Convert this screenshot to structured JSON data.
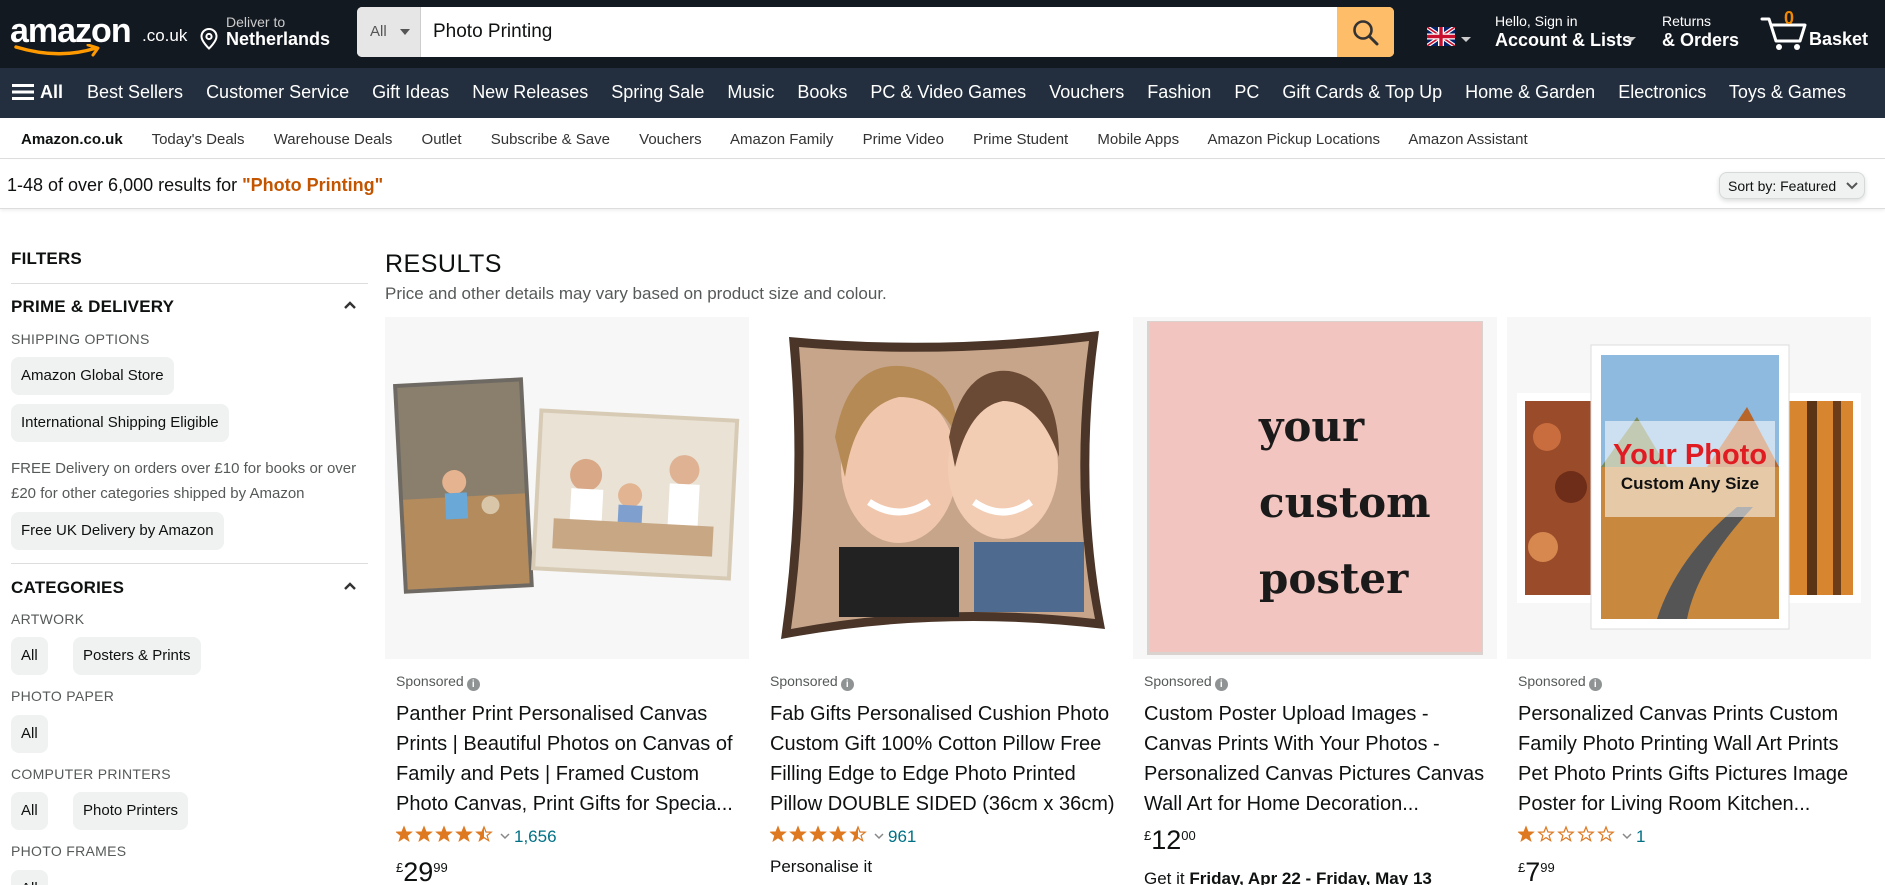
{
  "header": {
    "logo_text": "amazon",
    "logo_tld": ".co.uk",
    "deliver_line1": "Deliver to",
    "deliver_line2": "Netherlands",
    "search_category": "All",
    "search_query": "Photo Printing",
    "account_line1": "Hello, Sign in",
    "account_line2": "Account & Lists",
    "orders_line1": "Returns",
    "orders_line2": "& Orders",
    "basket_count": "0",
    "basket_label": "Basket",
    "accent_color": "#febd69"
  },
  "main_nav": {
    "all_label": "All",
    "items": [
      "Best Sellers",
      "Customer Service",
      "Gift Ideas",
      "New Releases",
      "Spring Sale",
      "Music",
      "Books",
      "PC & Video Games",
      "Vouchers",
      "Fashion",
      "PC",
      "Gift Cards & Top Up",
      "Home & Garden",
      "Electronics",
      "Toys & Games"
    ]
  },
  "sub_nav": {
    "items": [
      "Amazon.co.uk",
      "Today's Deals",
      "Warehouse Deals",
      "Outlet",
      "Subscribe & Save",
      "Vouchers",
      "Amazon Family",
      "Prime Video",
      "Prime Student",
      "Mobile Apps",
      "Amazon Pickup Locations",
      "Amazon Assistant"
    ]
  },
  "results_bar": {
    "count_text": "1-48 of over 6,000 results for ",
    "query_text": "\"Photo Printing\"",
    "sort_label": "Sort by:  Featured"
  },
  "filters": {
    "title": "FILTERS",
    "prime_section": "PRIME & DELIVERY",
    "shipping_options": "SHIPPING OPTIONS",
    "chip_global_store": "Amazon Global Store",
    "chip_international": "International Shipping Eligible",
    "free_delivery_note": "FREE Delivery on orders over £10 for books or over £20 for other categories shipped by Amazon",
    "chip_free_uk": "Free UK Delivery by Amazon",
    "categories_section": "CATEGORIES",
    "artwork": "ARTWORK",
    "chip_all": "All",
    "chip_posters": "Posters & Prints",
    "photo_paper": "PHOTO PAPER",
    "computer_printers": "COMPUTER PRINTERS",
    "chip_photo_printers": "Photo Printers",
    "photo_frames": "PHOTO FRAMES"
  },
  "results": {
    "title": "RESULTS",
    "subtitle": "Price and other details may vary based on product size and colour.",
    "sponsored_label": "Sponsored",
    "products": [
      {
        "title": "Panther Print Personalised Canvas Prints | Beautiful Photos on Canvas of Family and Pets | Framed Custom Photo Canvas, Print Gifts for Specia...",
        "rating": 4.5,
        "reviews": "1,656",
        "currency": "£",
        "price_whole": "29",
        "price_frac": "99"
      },
      {
        "title": "Fab Gifts Personalised Cushion Photo Custom Gift 100% Cotton Pillow Free Filling Edge to Edge Photo Printed Pillow DOUBLE SIDED (36cm x 36cm)",
        "rating": 4.5,
        "reviews": "961",
        "extra": "Personalise it"
      },
      {
        "title": "Custom Poster Upload Images - Canvas Prints With Your Photos - Personalized Canvas Pictures Canvas Wall Art for Home Decoration...",
        "image_text": [
          "your",
          "custom",
          "poster"
        ],
        "currency": "£",
        "price_whole": "12",
        "price_frac": "00",
        "delivery_prefix": "Get it ",
        "delivery_dates": "Friday, Apr 22 - Friday, May 13"
      },
      {
        "title": "Personalized Canvas Prints Custom Family Photo Printing Wall Art Prints Pet Photo Prints Gifts Pictures Image Poster for Living Room Kitchen...",
        "image_text_1": "Your Photo",
        "image_text_2": "Custom Any Size",
        "rating": 1,
        "reviews": "1",
        "currency": "£",
        "price_whole": "7",
        "price_frac": "99"
      }
    ]
  }
}
